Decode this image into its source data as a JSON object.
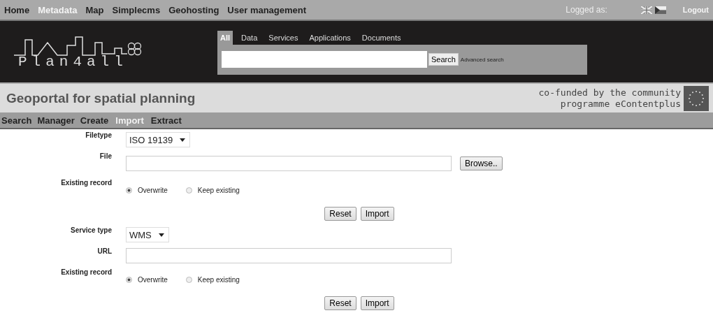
{
  "top_menu": [
    {
      "label": "Home",
      "selected": false
    },
    {
      "label": "Metadata",
      "selected": true
    },
    {
      "label": "Map",
      "selected": false
    },
    {
      "label": "Simplecms",
      "selected": false
    },
    {
      "label": "Geohosting",
      "selected": false
    },
    {
      "label": "User management",
      "selected": false
    }
  ],
  "logged_as": "Logged as:",
  "logout": "Logout",
  "logo": {
    "text": "Plan4all"
  },
  "search": {
    "tabs": [
      {
        "label": "All",
        "selected": true
      },
      {
        "label": "Data",
        "selected": false
      },
      {
        "label": "Services",
        "selected": false
      },
      {
        "label": "Applications",
        "selected": false
      },
      {
        "label": "Documents",
        "selected": false
      }
    ],
    "button": "Search",
    "advanced": "Advanced search"
  },
  "title": "Geoportal for spatial planning",
  "funding": [
    "co-funded by the community",
    "programme eContentplus"
  ],
  "sub_menu": [
    {
      "label": "Search",
      "selected": false
    },
    {
      "label": "Manager",
      "selected": false
    },
    {
      "label": "Create",
      "selected": false
    },
    {
      "label": "Import",
      "selected": true
    },
    {
      "label": "Extract",
      "selected": false
    }
  ],
  "forms": [
    {
      "fields": [
        {
          "kind": "select",
          "label": "Filetype",
          "value": "ISO 19139"
        },
        {
          "kind": "file",
          "label": "File",
          "button": "Browse.."
        },
        {
          "kind": "radio",
          "label": "Existing record",
          "options": [
            {
              "label": "Overwrite",
              "selected": true
            },
            {
              "label": "Keep existing",
              "selected": false
            }
          ]
        }
      ],
      "buttons": [
        "Reset",
        "Import"
      ]
    },
    {
      "fields": [
        {
          "kind": "select",
          "label": "Service type",
          "value": "WMS"
        },
        {
          "kind": "text",
          "label": "URL"
        },
        {
          "kind": "radio",
          "label": "Existing record",
          "options": [
            {
              "label": "Overwrite",
              "selected": true
            },
            {
              "label": "Keep existing",
              "selected": false
            }
          ]
        }
      ],
      "buttons": [
        "Reset",
        "Import"
      ]
    }
  ]
}
